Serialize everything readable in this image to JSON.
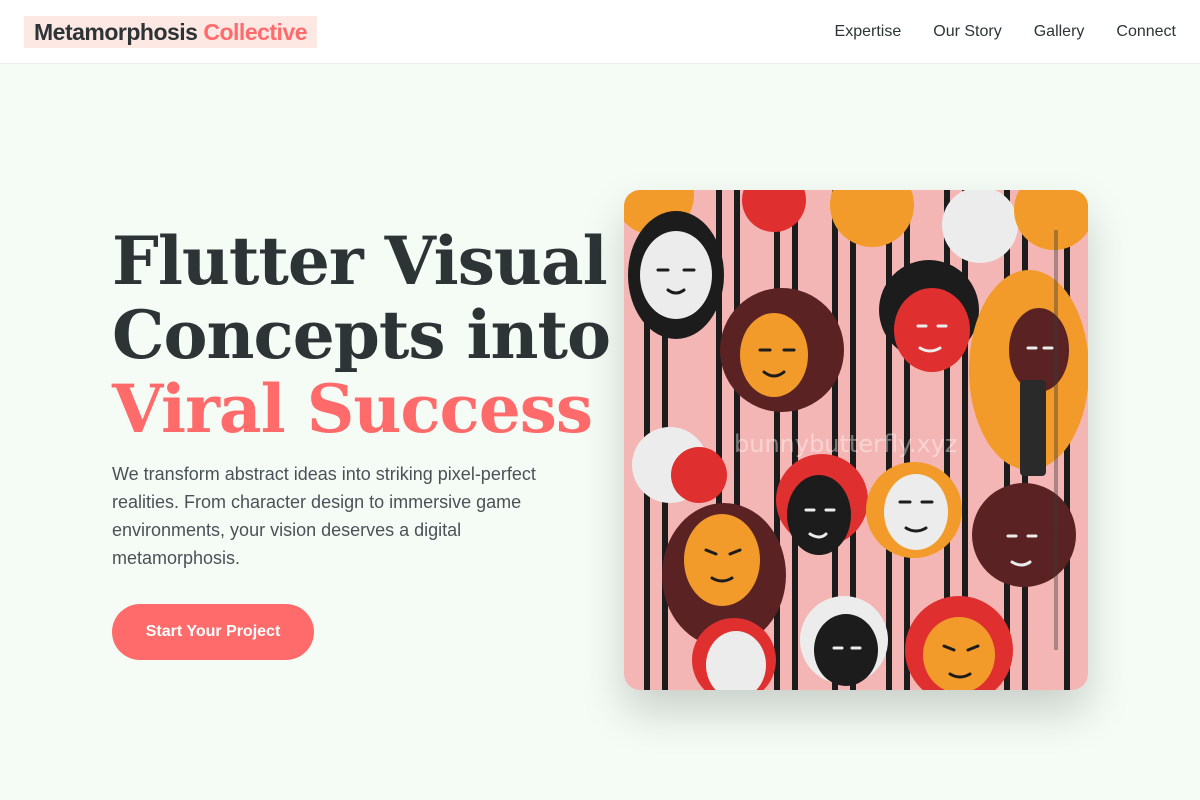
{
  "header": {
    "logo_primary": "Metamorphosis",
    "logo_accent": "Collective",
    "nav": [
      "Expertise",
      "Our Story",
      "Gallery",
      "Connect"
    ]
  },
  "hero": {
    "title_line1": "Flutter Visual",
    "title_line2": "Concepts into",
    "title_accent": "Viral Success",
    "description": "We transform abstract ideas into striking pixel-perfect realities. From character design to immersive game environments, your vision deserves a digital metamorphosis.",
    "cta_label": "Start Your Project"
  },
  "artwork": {
    "watermark": "bunnybutterfly.xyz"
  },
  "colors": {
    "accent": "#ff6b6b",
    "text": "#2d3436",
    "background": "#f5fcf5",
    "logo_bg": "#fde8e4"
  }
}
